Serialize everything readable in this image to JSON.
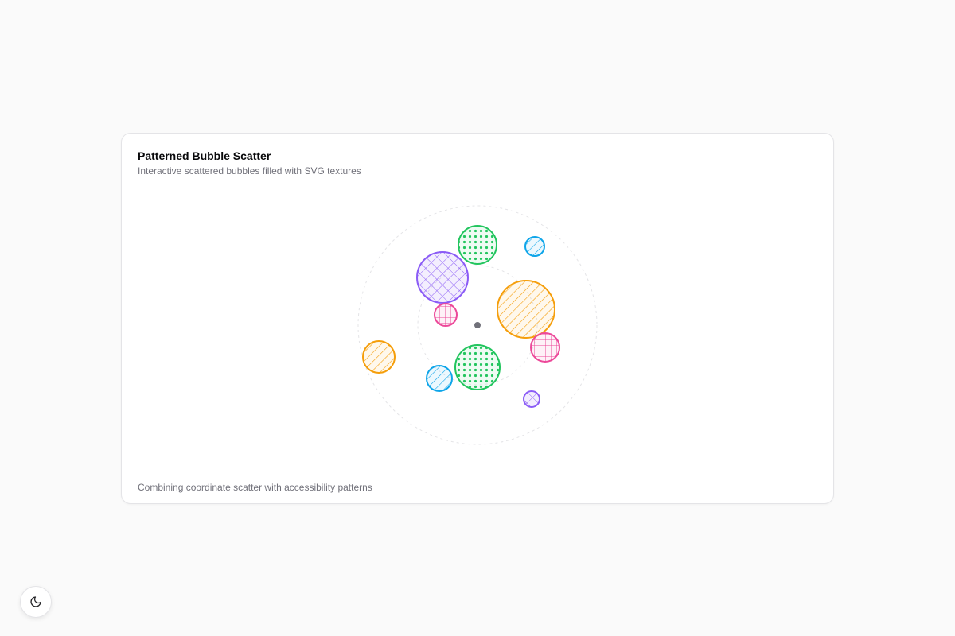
{
  "card": {
    "title": "Patterned Bubble Scatter",
    "subtitle": "Interactive scattered bubbles filled with SVG textures",
    "footer": "Combining coordinate scatter with accessibility patterns"
  },
  "theme_toggle": {
    "icon": "moon-icon"
  },
  "colors": {
    "orange": "#f59e0b",
    "green": "#22c55e",
    "purple": "#8b5cf6",
    "pink": "#ec4899",
    "blue": "#0ea5e9",
    "center": "#71717a",
    "guide": "#e4e4e7"
  },
  "chart_data": {
    "type": "scatter",
    "title": "Patterned Bubble Scatter",
    "xlim": [
      -150,
      150
    ],
    "ylim": [
      -150,
      150
    ],
    "grid": false,
    "guide_rings": [
      150,
      75
    ],
    "center_point": [
      0,
      0
    ],
    "points": [
      {
        "x": 0,
        "y": 101,
        "r": 24,
        "color": "green",
        "pattern": "dots"
      },
      {
        "x": 72,
        "y": 99,
        "r": 12,
        "color": "blue",
        "pattern": "diagonal"
      },
      {
        "x": -44,
        "y": 60,
        "r": 32,
        "color": "purple",
        "pattern": "crosshatch"
      },
      {
        "x": 61,
        "y": 20,
        "r": 36,
        "color": "orange",
        "pattern": "diagonal"
      },
      {
        "x": -40,
        "y": 13,
        "r": 14,
        "color": "pink",
        "pattern": "grid"
      },
      {
        "x": 85,
        "y": -28,
        "r": 18,
        "color": "pink",
        "pattern": "grid"
      },
      {
        "x": -124,
        "y": -40,
        "r": 20,
        "color": "orange",
        "pattern": "diagonal"
      },
      {
        "x": 0,
        "y": -53,
        "r": 28,
        "color": "green",
        "pattern": "dots"
      },
      {
        "x": -48,
        "y": -67,
        "r": 16,
        "color": "blue",
        "pattern": "diagonal"
      },
      {
        "x": 68,
        "y": -93,
        "r": 10,
        "color": "purple",
        "pattern": "crosshatch"
      }
    ]
  }
}
